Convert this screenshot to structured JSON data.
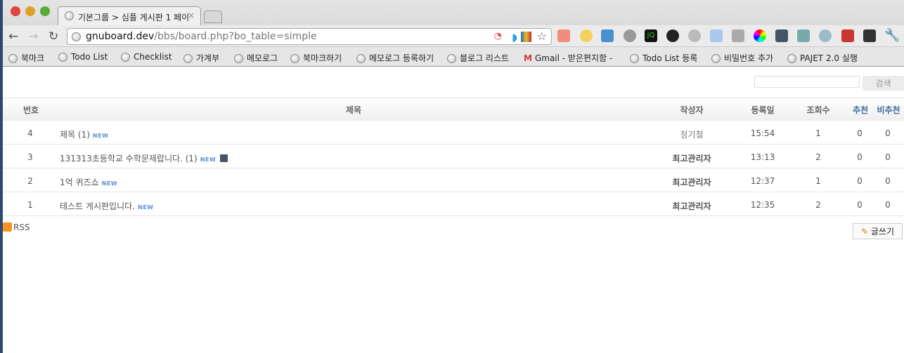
{
  "browser": {
    "tab_title": "기본그룹 > 심플 게시판 1 페이",
    "url_host": "gnuboard.dev",
    "url_path": "/bbs/board.php?bo_table=simple",
    "bookmarks": [
      "북마크",
      "Todo List",
      "Checklist",
      "가계부",
      "메모로그",
      "북마크하기",
      "메모로그 등록하기",
      "블로그 리스트",
      "Gmail - 받은편지함 -",
      "Todo List 등록",
      "비밀번호 추가",
      "PAJET 2.0 실행"
    ]
  },
  "board": {
    "search_button": "검색",
    "columns": [
      "번호",
      "제목",
      "작성자",
      "등록일",
      "조회수",
      "추천",
      "비추천"
    ],
    "new_badge": "NEW",
    "rows": [
      {
        "num": "4",
        "subject": "제목 (1)",
        "author": "정기철",
        "date": "15:54",
        "hits": "1",
        "good": "0",
        "bad": "0",
        "file": false,
        "bold": false
      },
      {
        "num": "3",
        "subject": "131313초등학교 수학문제랍니다. (1)",
        "author": "최고관리자",
        "date": "13:13",
        "hits": "2",
        "good": "0",
        "bad": "0",
        "file": true,
        "bold": true
      },
      {
        "num": "2",
        "subject": "1억 퀴즈쇼",
        "author": "최고관리자",
        "date": "12:37",
        "hits": "1",
        "good": "0",
        "bad": "0",
        "file": false,
        "bold": true
      },
      {
        "num": "1",
        "subject": "테스트 게시판입니다.",
        "author": "최고관리자",
        "date": "12:35",
        "hits": "2",
        "good": "0",
        "bad": "0",
        "file": false,
        "bold": true
      }
    ],
    "rss_label": "RSS",
    "write_button": "글쓰기"
  }
}
